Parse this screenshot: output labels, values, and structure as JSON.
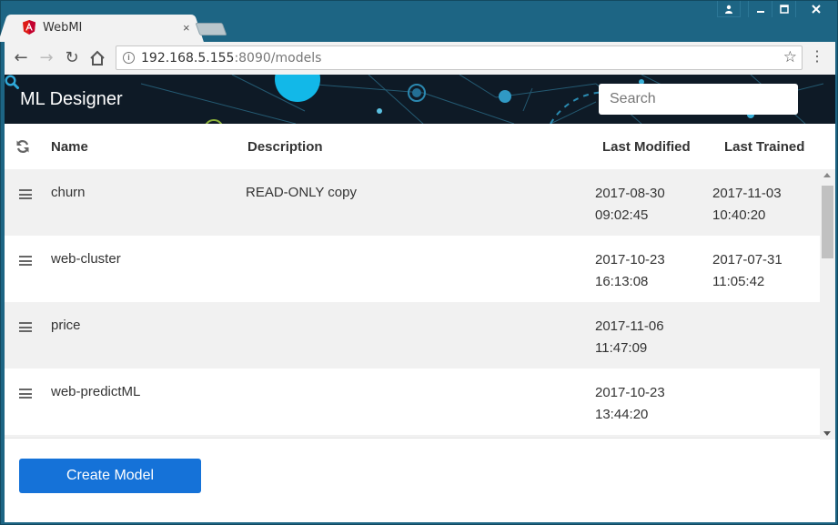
{
  "browser": {
    "tab_title": "WebMI",
    "tab_close": "×",
    "url_host": "192.168.5.155",
    "url_rest": ":8090/models",
    "window_controls": [
      "user-icon",
      "minimize-icon",
      "maximize-icon",
      "close-icon"
    ]
  },
  "app": {
    "title": "ML Designer",
    "search_placeholder": "Search",
    "accent_color": "#1572d8"
  },
  "table": {
    "headers": {
      "name": "Name",
      "description": "Description",
      "last_modified": "Last Modified",
      "last_trained": "Last Trained"
    },
    "rows": [
      {
        "name": "churn",
        "description": "READ-ONLY copy",
        "modified_date": "2017-08-30",
        "modified_time": "09:02:45",
        "trained_date": "2017-11-03",
        "trained_time": "10:40:20"
      },
      {
        "name": "web-cluster",
        "description": "",
        "modified_date": "2017-10-23",
        "modified_time": "16:13:08",
        "trained_date": "2017-07-31",
        "trained_time": "11:05:42"
      },
      {
        "name": "price",
        "description": "",
        "modified_date": "2017-11-06",
        "modified_time": "11:47:09",
        "trained_date": "",
        "trained_time": ""
      },
      {
        "name": "web-predictML",
        "description": "",
        "modified_date": "2017-10-23",
        "modified_time": "13:44:20",
        "trained_date": "",
        "trained_time": ""
      }
    ]
  },
  "footer": {
    "create_label": "Create Model"
  }
}
